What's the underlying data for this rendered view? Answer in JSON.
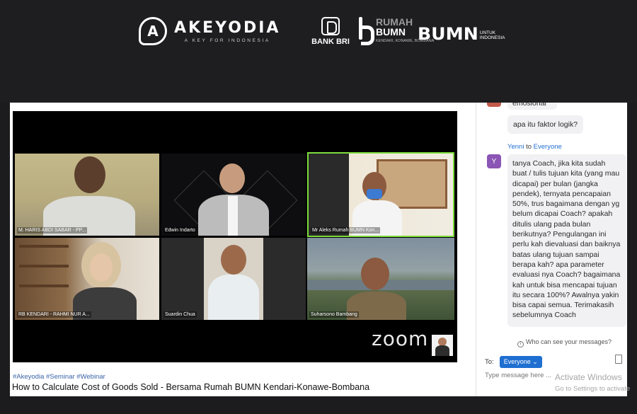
{
  "header": {
    "akeyodia": {
      "mark": "A",
      "title": "AKEYODIA",
      "tagline": "A KEY FOR INDONESIA"
    },
    "bri": {
      "label": "BANK BRI"
    },
    "rumah": {
      "line1": "RUMAH",
      "line2": "BUMN",
      "sub": "KENDARI, KONAWE, BOMBANA"
    },
    "bumn": {
      "label": "BUMN",
      "sub1": "UNTUK",
      "sub2": "INDONESIA"
    }
  },
  "participants": [
    {
      "name": "M. HARIS ABDI SABAR - PP..."
    },
    {
      "name": "Edwin Indarto"
    },
    {
      "name": "Mr Aleks Rumah BUMN Kon..."
    },
    {
      "name": "RB KENDARI - RAHMI NUR A..."
    },
    {
      "name": "Suardin Chua"
    },
    {
      "name": "Suharsono Bambang"
    }
  ],
  "video": {
    "brand": "zoom"
  },
  "meta": {
    "tags": "#Akeyodia #Seminar #Webinar",
    "title": "How to Calculate Cost of Goods Sold - Bersama Rumah BUMN Kendari-Konawe-Bombana"
  },
  "chat": {
    "partial_message": "emosional",
    "message1": "apa itu faktor logik?",
    "sender": {
      "name": "Yenni",
      "to_word": "to",
      "recipient": "Everyone",
      "avatar": "Y"
    },
    "message2": "tanya Coach, jika kita sudah buat / tulis tujuan kita (yang mau dicapai) per bulan (jangka pendek), ternyata pencapaian 50%, trus bagaimana dengan yg belum dicapai Coach? apakah ditulis ulang pada bulan berikutnya? Pengulangan ini perlu kah dievaluasi dan baiknya batas ulang tujuan sampai berapa kah? apa parameter evaluasi nya Coach? bagaimana kah untuk bisa mencapai tujuan itu secara 100%? Awalnya yakin bisa capai semua. Terimakasih sebelumnya Coach",
    "who_can_see": "Who can see your messages?",
    "to_label": "To:",
    "to_value": "Everyone ⌄",
    "input_placeholder": "Type message here ...",
    "watermark_title": "Activate Windows",
    "watermark_sub": "Go to Settings to activate"
  }
}
